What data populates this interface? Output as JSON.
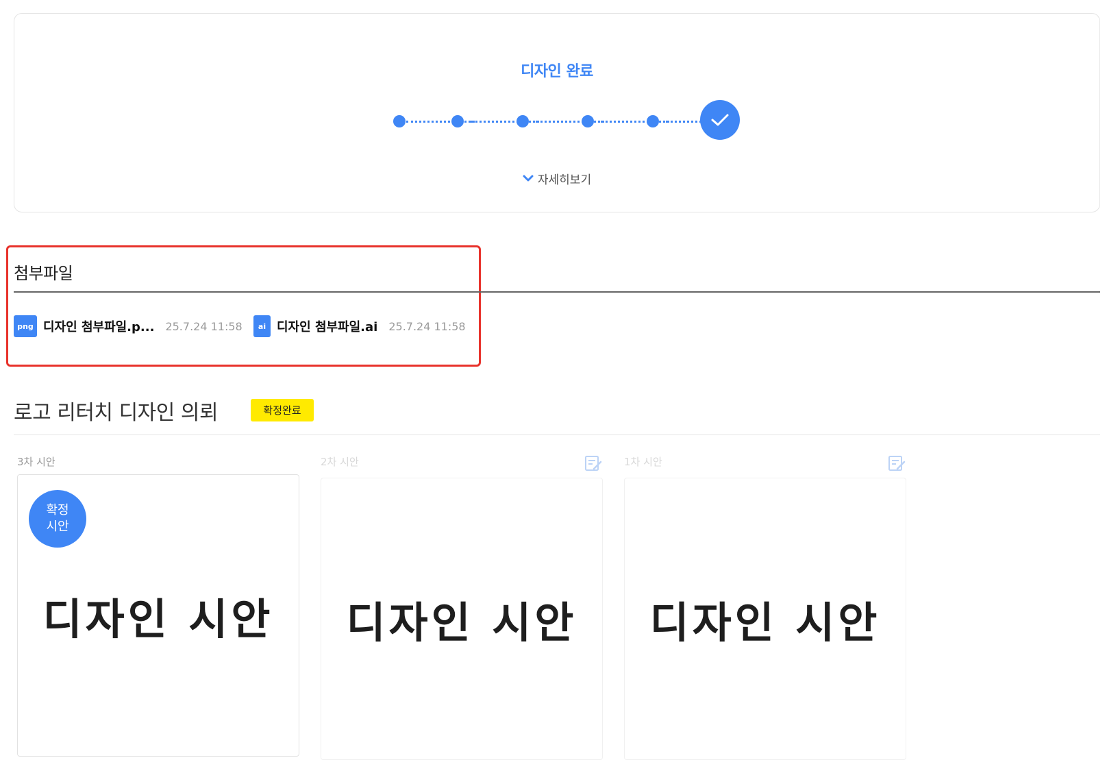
{
  "status": {
    "title": "디자인 완료",
    "details_label": "자세히보기",
    "steps_completed": 6,
    "steps_total": 6
  },
  "attachments": {
    "title": "첨부파일",
    "files": [
      {
        "badge": "png",
        "name": "디자인 첨부파일.p...",
        "date": "25.7.24 11:58"
      },
      {
        "badge": "ai",
        "name": "디자인 첨부파일.ai",
        "date": "25.7.24 11:58"
      }
    ]
  },
  "request": {
    "title": "로고 리터치 디자인 의뢰",
    "status_badge": "확정완료"
  },
  "drafts": [
    {
      "label": "3차 시안",
      "text": "디자인 시안",
      "confirmed_line1": "확정",
      "confirmed_line2": "시안",
      "confirmed": true
    },
    {
      "label": "2차 시안",
      "text": "디자인 시안",
      "confirmed": false
    },
    {
      "label": "1차 시안",
      "text": "디자인 시안",
      "confirmed": false
    }
  ],
  "colors": {
    "accent": "#3f86f5",
    "badge_yellow": "#ffea00",
    "highlight_red": "#e8322b"
  },
  "icons": {
    "check": "check-icon",
    "chevron": "chevron-down-icon",
    "edit": "edit-icon"
  }
}
